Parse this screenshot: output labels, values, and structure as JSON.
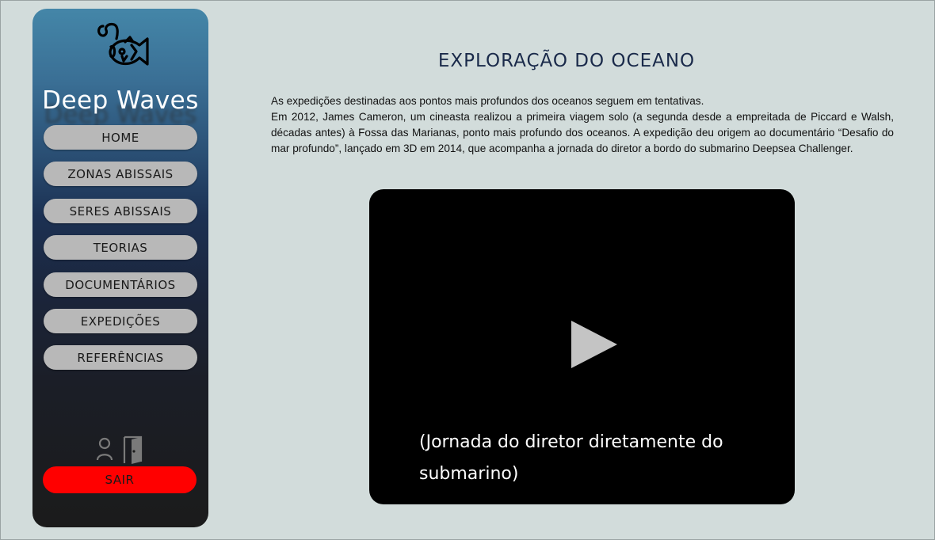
{
  "sidebar": {
    "brand": "Deep Waves",
    "logo_icon": "anglerfish-icon",
    "nav": [
      {
        "label": "HOME"
      },
      {
        "label": "ZONAS ABISSAIS"
      },
      {
        "label": "SERES ABISSAIS"
      },
      {
        "label": "TEORIAS"
      },
      {
        "label": "DOCUMENTÁRIOS"
      },
      {
        "label": "EXPEDIÇÕES"
      },
      {
        "label": "REFERÊNCIAS"
      }
    ],
    "user_icon": "user-icon",
    "door_icon": "door-exit-icon",
    "logout_label": "SAIR",
    "logout_color": "#ff0000"
  },
  "main": {
    "title": "EXPLORAÇÃO DO OCEANO",
    "paragraphs": [
      "As expedições destinadas aos pontos mais profundos dos oceanos seguem em tentativas.",
      "Em 2012, James Cameron, um cineasta realizou a primeira viagem solo (a segunda desde a empreitada de Piccard e Walsh, décadas antes) à Fossa das Marianas, ponto mais profundo dos oceanos. A expedição deu origem ao documentário “Desafio do mar profundo”, lançado em 3D em 2014, que acompanha a jornada do diretor a bordo do submarino Deepsea Challenger."
    ],
    "video": {
      "play_icon": "play-icon",
      "caption": "(Jornada do diretor diretamente do submarino)"
    }
  }
}
